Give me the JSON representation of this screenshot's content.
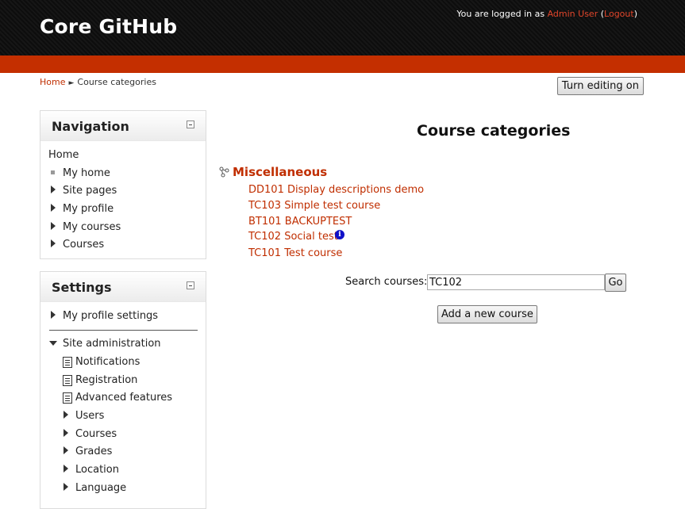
{
  "header": {
    "site_title": "Core GitHub",
    "login_prefix": "You are logged in as ",
    "user_name": "Admin User",
    "logout_open": " (",
    "logout_label": "Logout",
    "logout_close": ")"
  },
  "breadcrumb": {
    "home": "Home",
    "separator": "►",
    "current": "Course categories"
  },
  "edit_button": "Turn editing on",
  "navigation": {
    "title": "Navigation",
    "items": [
      {
        "label": "Home"
      },
      {
        "label": "My home"
      },
      {
        "label": "Site pages"
      },
      {
        "label": "My profile"
      },
      {
        "label": "My courses"
      },
      {
        "label": "Courses"
      }
    ]
  },
  "settings": {
    "title": "Settings",
    "profile_settings": "My profile settings",
    "site_admin": "Site administration",
    "admin_links": [
      {
        "label": "Notifications"
      },
      {
        "label": "Registration"
      },
      {
        "label": "Advanced features"
      }
    ],
    "admin_folders": [
      {
        "label": "Users"
      },
      {
        "label": "Courses"
      },
      {
        "label": "Grades"
      },
      {
        "label": "Location"
      },
      {
        "label": "Language"
      }
    ]
  },
  "main": {
    "heading": "Course categories",
    "category": "Miscellaneous",
    "courses": [
      {
        "label": "DD101 Display descriptions demo"
      },
      {
        "label": "TC103 Simple test course"
      },
      {
        "label": "BT101 BACKUPTEST"
      },
      {
        "label": "TC102 Social test"
      },
      {
        "label": "TC101 Test course"
      }
    ],
    "info_glyph": "i",
    "search_label": "Search courses:",
    "search_value": "TC102",
    "go_label": "Go",
    "add_course_label": "Add a new course"
  },
  "colors": {
    "accent": "#c42f00",
    "link": "#c02e00",
    "header_bg": "#0d0d0d"
  }
}
